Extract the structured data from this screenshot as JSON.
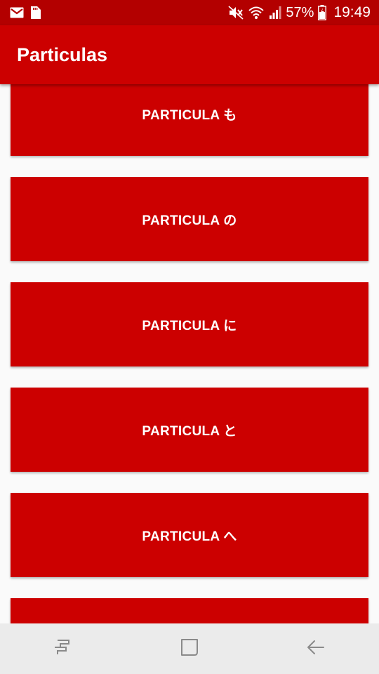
{
  "status_bar": {
    "battery": "57%",
    "time": "19:49",
    "icons": [
      "gmail-icon",
      "sd-card-icon",
      "mute-icon",
      "wifi-icon",
      "signal-icon",
      "battery-icon"
    ]
  },
  "app_bar": {
    "title": "Particulas"
  },
  "list": {
    "items": [
      {
        "label": "PARTICULA も"
      },
      {
        "label": "PARTICULA の"
      },
      {
        "label": "PARTICULA に"
      },
      {
        "label": "PARTICULA と"
      },
      {
        "label": "PARTICULA へ"
      },
      {
        "label": ""
      }
    ]
  },
  "nav_bar": {
    "icons": [
      "recents-icon",
      "home-icon",
      "back-icon"
    ]
  },
  "colors": {
    "status_bar": "#b30000",
    "primary": "#cc0000",
    "background": "#fafafa",
    "nav_bar": "#ebebeb"
  }
}
